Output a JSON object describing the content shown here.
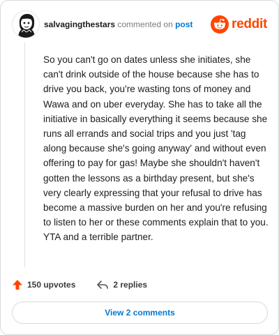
{
  "header": {
    "username": "salvagingthestars",
    "action": " commented on ",
    "link": "post"
  },
  "brand": {
    "wordmark": "reddit",
    "color": "#ff4500",
    "icon": "reddit-alien-icon"
  },
  "comment": {
    "body": "So you can't go on dates unless she initiates, she can't drink outside of the house because she has to drive you back, you're wasting tons of money and Wawa and on uber everyday. She has to take all the initiative in basically everything it seems because she runs all errands and social trips and you just 'tag along because she's going anyway' and without even offering to pay for gas! Maybe she shouldn't haven't gotten the lessons as a birthday present, but she's very clearly expressing that your refusal to drive has become a massive burden on her and you're refusing to listen to her or these comments explain that to you. YTA and a terrible partner."
  },
  "actions": {
    "upvotes": "150 upvotes",
    "replies": "2 replies",
    "upvote_icon": "upvote-arrow-icon",
    "reply_icon": "reply-icon"
  },
  "footer": {
    "view_comments": "View 2 comments"
  }
}
